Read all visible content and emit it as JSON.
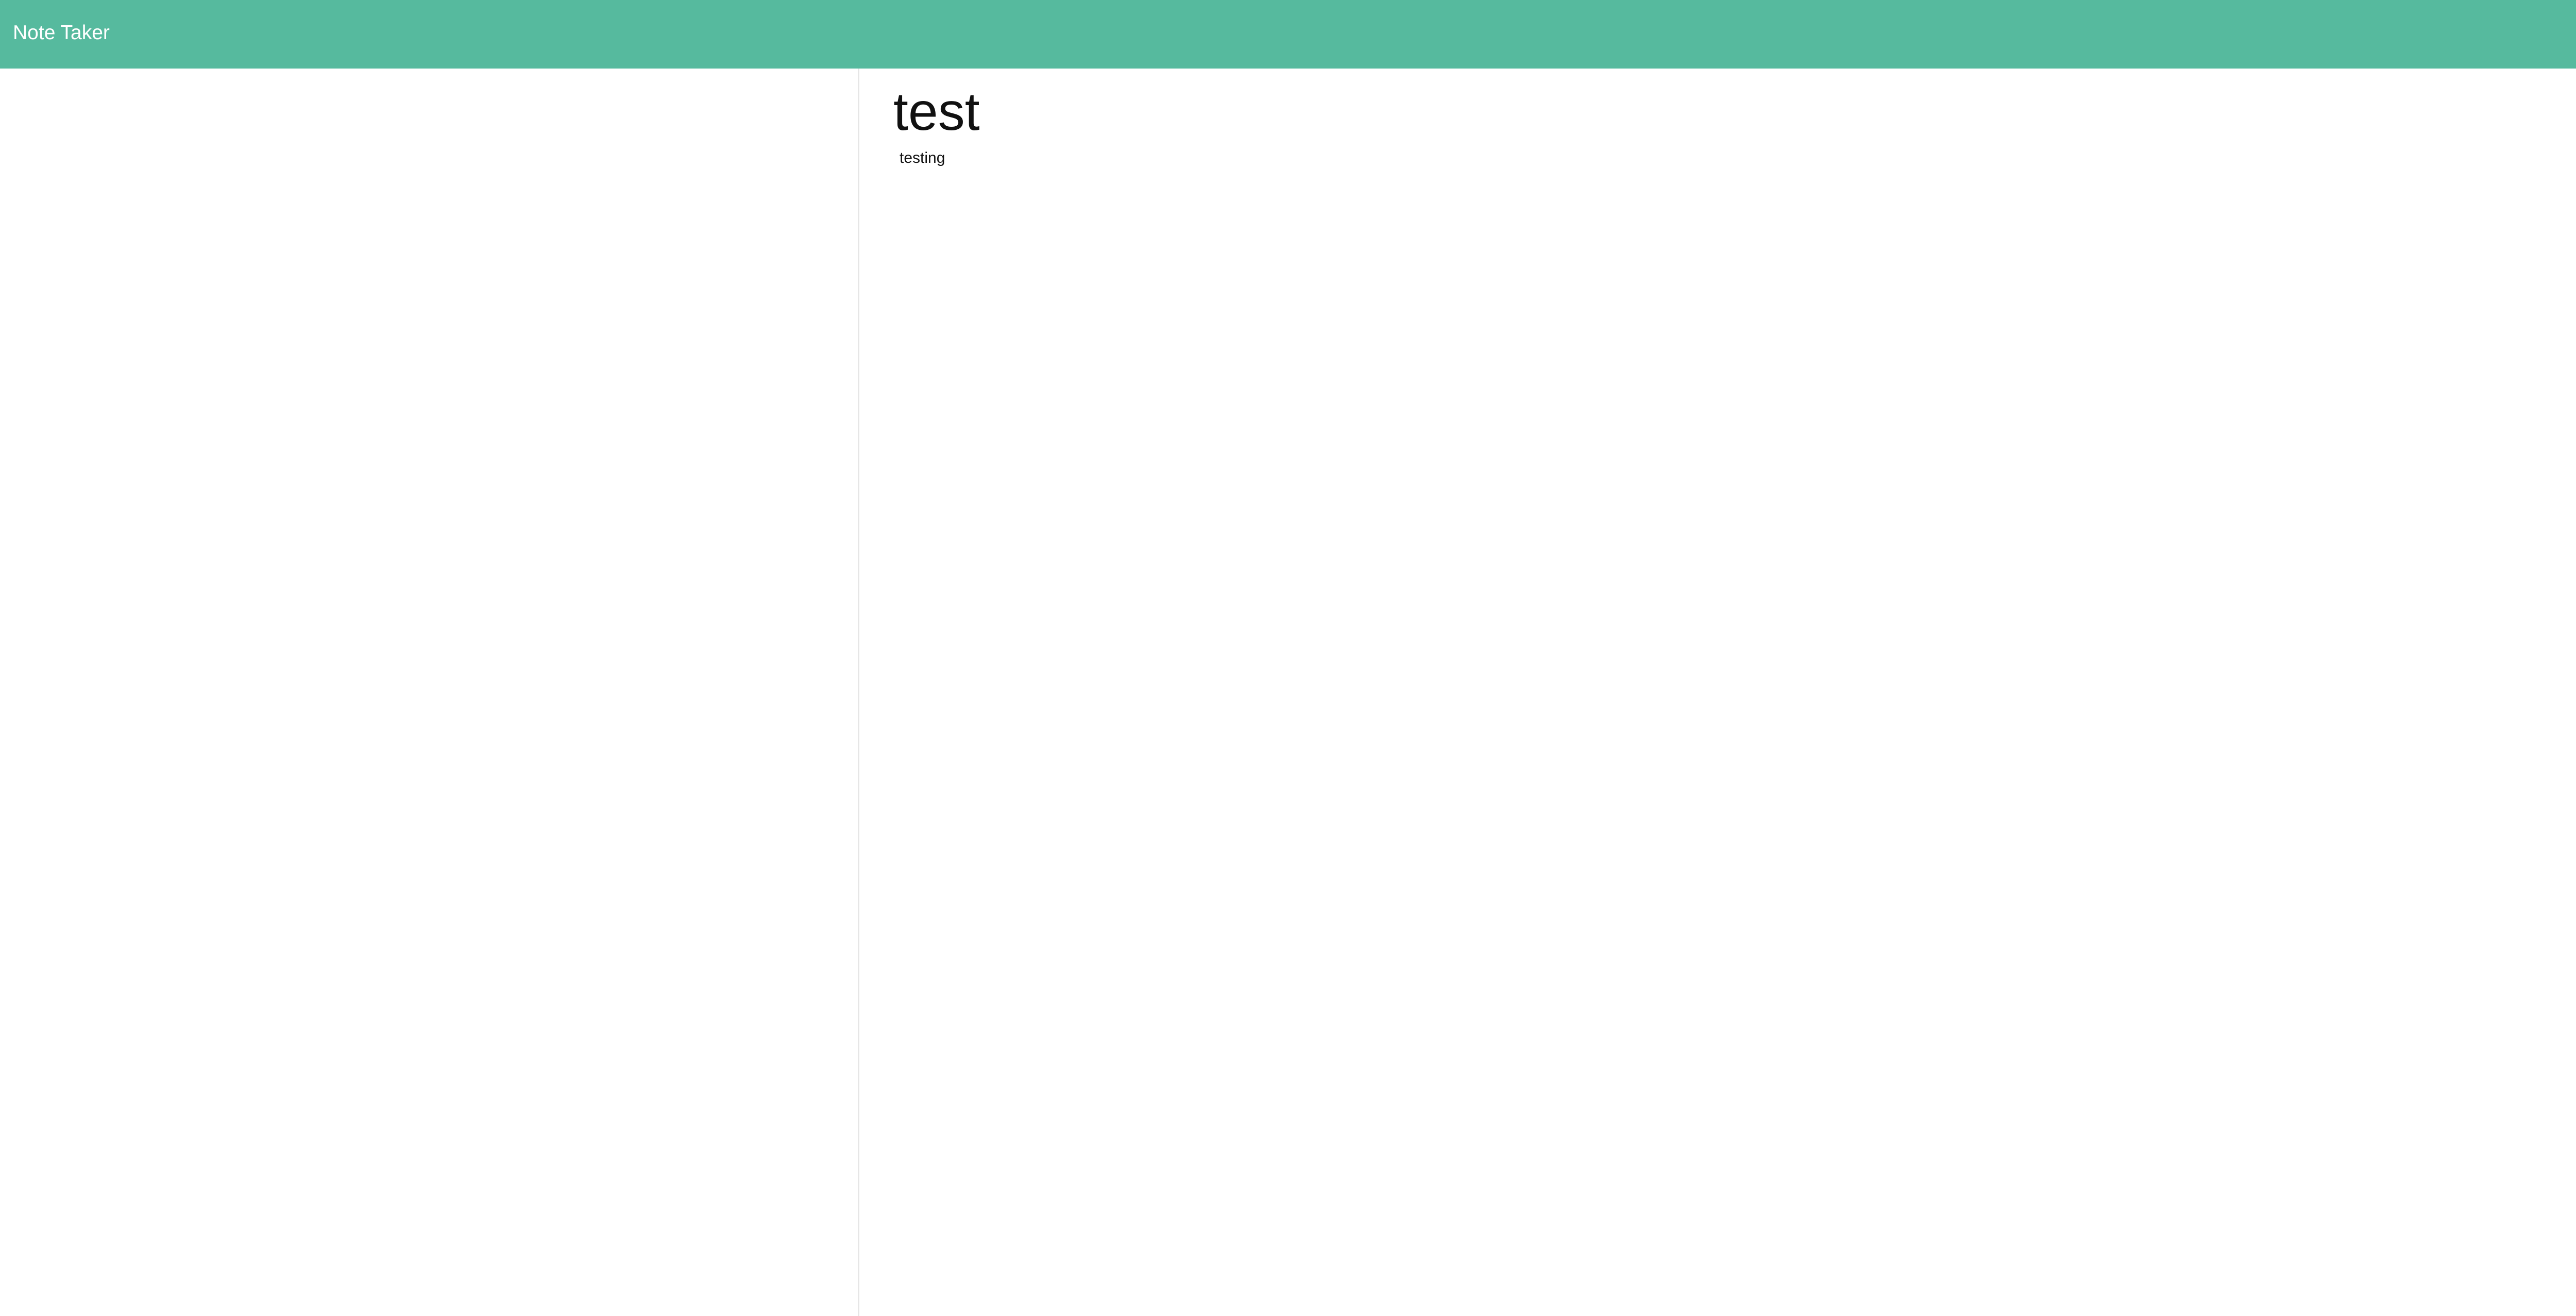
{
  "navbar": {
    "title": "Note Taker",
    "new_note_icon": "pencil-icon",
    "background_color": "#56ba9e"
  },
  "note": {
    "title": "test",
    "body": "testing"
  }
}
